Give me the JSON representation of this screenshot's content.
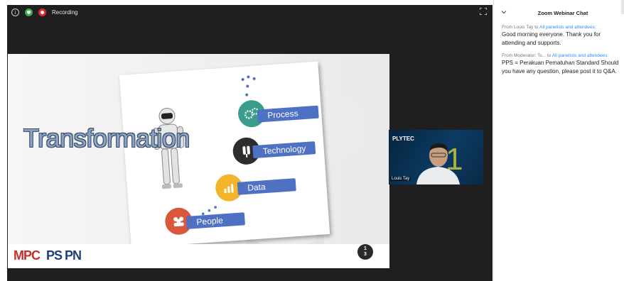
{
  "toolbar": {
    "icons": [
      "info-icon",
      "shield-icon",
      "record-icon",
      "fullscreen-icon"
    ],
    "recording_label": "Recording"
  },
  "slide": {
    "title": "Transformation",
    "items": [
      "Process",
      "Technology",
      "Data",
      "People"
    ],
    "page_number_top": "1",
    "page_number_bottom": "3",
    "logo_text": "MPC PS PN"
  },
  "webcam": {
    "banner": "PLYTEC",
    "participant_name": "Louis Tay"
  },
  "chat": {
    "title": "Zoom Webinar Chat",
    "messages": [
      {
        "from": "From Louis Tay to ",
        "to": "All panelists and attendees:",
        "body": "Good morning everyone. Thank you for attending and supports."
      },
      {
        "from": "From Moderator: Ts... to ",
        "to": "All panelists and attendees:",
        "body": "PPS = Perakuan Pematuhan Standard Should you have any question, please post it to Q&A."
      }
    ]
  },
  "colors": {
    "stage": "#1f1f1f",
    "record": "#e02a2a",
    "shield": "#2fae49",
    "chat_link": "#2d8cff",
    "ribbon": "#4f71c4"
  }
}
